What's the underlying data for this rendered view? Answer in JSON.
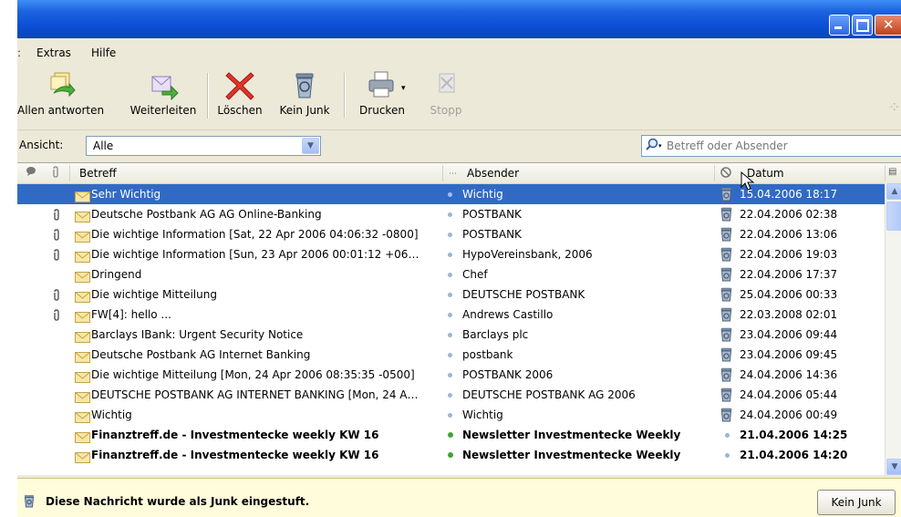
{
  "menu": {
    "prefix": ":",
    "items": [
      "Extras",
      "Hilfe"
    ]
  },
  "toolbar": {
    "reply_all": "Allen antworten",
    "forward": "Weiterleiten",
    "delete": "Löschen",
    "not_junk": "Kein Junk",
    "print": "Drucken",
    "stop": "Stopp"
  },
  "view": {
    "label": "Ansicht:",
    "value": "Alle"
  },
  "search": {
    "placeholder": "Betreff oder Absender"
  },
  "columns": {
    "subject": "Betreff",
    "sender": "Absender",
    "date": "Datum"
  },
  "messages": [
    {
      "subject": "Sehr Wichtig",
      "sender": "Wichtig",
      "date": "15.04.2006 18:17",
      "attachment": false,
      "junk": true,
      "selected": true,
      "bold": false
    },
    {
      "subject": "Deutsche Postbank AG AG Online-Banking",
      "sender": "POSTBANK",
      "date": "22.04.2006 02:38",
      "attachment": true,
      "junk": true,
      "selected": false,
      "bold": false
    },
    {
      "subject": "Die wichtige Information [Sat, 22 Apr 2006 04:06:32 -0800]",
      "sender": "POSTBANK",
      "date": "22.04.2006 13:06",
      "attachment": true,
      "junk": true,
      "selected": false,
      "bold": false
    },
    {
      "subject": "Die wichtige Information [Sun, 23 Apr 2006 00:01:12 +06…",
      "sender": "HypoVereinsbank, 2006",
      "date": "22.04.2006 19:03",
      "attachment": true,
      "junk": true,
      "selected": false,
      "bold": false
    },
    {
      "subject": "Dringend",
      "sender": "Chef",
      "date": "22.04.2006 17:37",
      "attachment": false,
      "junk": true,
      "selected": false,
      "bold": false
    },
    {
      "subject": "Die wichtige Mitteilung",
      "sender": "DEUTSCHE POSTBANK",
      "date": "25.04.2006 00:33",
      "attachment": true,
      "junk": true,
      "selected": false,
      "bold": false
    },
    {
      "subject": "FW[4]: hello ...",
      "sender": "Andrews Castillo",
      "date": "22.03.2008 02:01",
      "attachment": true,
      "junk": true,
      "selected": false,
      "bold": false
    },
    {
      "subject": "Barclays IBank: Urgent Security Notice",
      "sender": "Barclays plc",
      "date": "23.04.2006 09:44",
      "attachment": false,
      "junk": true,
      "selected": false,
      "bold": false
    },
    {
      "subject": "Deutsche Postbank AG Internet Banking",
      "sender": "postbank",
      "date": "23.04.2006 09:45",
      "attachment": false,
      "junk": true,
      "selected": false,
      "bold": false
    },
    {
      "subject": "Die wichtige Mitteilung [Mon, 24 Apr 2006 08:35:35 -0500]",
      "sender": "POSTBANK 2006",
      "date": "24.04.2006 14:36",
      "attachment": false,
      "junk": true,
      "selected": false,
      "bold": false
    },
    {
      "subject": "DEUTSCHE POSTBANK AG INTERNET BANKING [Mon, 24 A…",
      "sender": "DEUTSCHE POSTBANK AG 2006",
      "date": "24.04.2006 05:44",
      "attachment": false,
      "junk": true,
      "selected": false,
      "bold": false
    },
    {
      "subject": "Wichtig",
      "sender": "Wichtig",
      "date": "24.04.2006 00:49",
      "attachment": false,
      "junk": true,
      "selected": false,
      "bold": false
    },
    {
      "subject": "Finanztreff.de - Investmentecke weekly KW 16",
      "sender": "Newsletter Investmentecke Weekly",
      "date": "21.04.2006 14:25",
      "attachment": false,
      "junk": false,
      "selected": false,
      "bold": true
    },
    {
      "subject": "Finanztreff.de - Investmentecke weekly KW 16",
      "sender": "Newsletter Investmentecke Weekly",
      "date": "21.04.2006 14:20",
      "attachment": false,
      "junk": false,
      "selected": false,
      "bold": true
    }
  ],
  "junkbar": {
    "message": "Diese Nachricht wurde als Junk eingestuft.",
    "button": "Kein Junk"
  },
  "colors": {
    "titlebar": "#0a4fd4",
    "selection": "#316ac5",
    "junkbar_bg": "#fffcdb",
    "window_bg": "#ece9d8"
  }
}
